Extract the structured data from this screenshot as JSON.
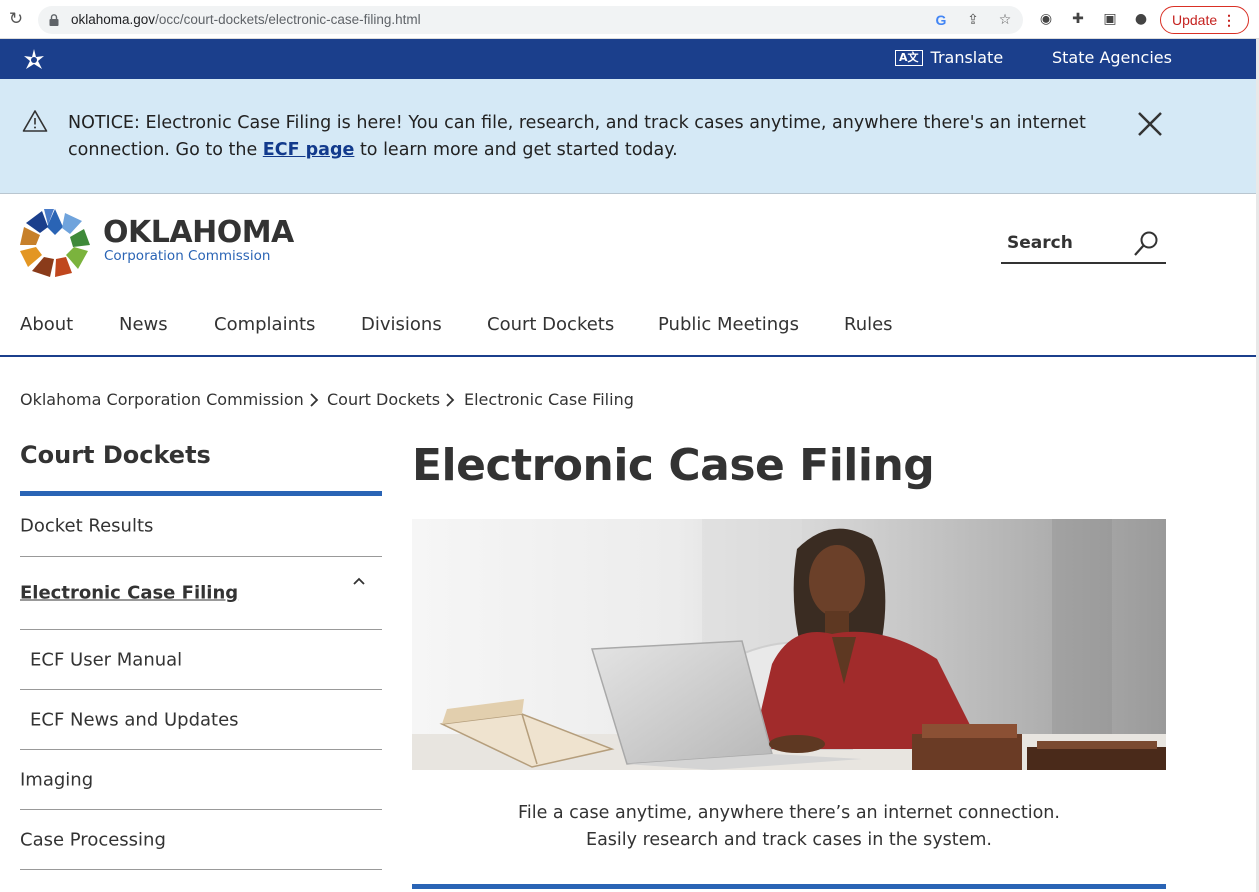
{
  "browser": {
    "url_host": "oklahoma.gov",
    "url_path": "/occ/court-dockets/electronic-case-filing.html",
    "update_label": "Update"
  },
  "state_bar": {
    "translate_label": "Translate",
    "translate_icon_text": "A文",
    "agencies_label": "State Agencies"
  },
  "notice": {
    "text_before": "NOTICE: Electronic Case Filing is here! You can file, research, and track cases anytime, anywhere there's an internet connection. Go to the ",
    "link_text": "ECF page",
    "text_after": " to learn more and get started today."
  },
  "logo": {
    "name": "OKLAHOMA",
    "subtitle": "Corporation Commission"
  },
  "search": {
    "label": "Search"
  },
  "nav": {
    "items": [
      {
        "label": "About"
      },
      {
        "label": "News"
      },
      {
        "label": "Complaints"
      },
      {
        "label": "Divisions"
      },
      {
        "label": "Court Dockets"
      },
      {
        "label": "Public Meetings"
      },
      {
        "label": "Rules"
      }
    ]
  },
  "breadcrumb": {
    "items": [
      {
        "label": "Oklahoma Corporation Commission"
      },
      {
        "label": "Court Dockets"
      },
      {
        "label": "Electronic Case Filing"
      }
    ]
  },
  "sidebar": {
    "title": "Court Dockets",
    "items": [
      {
        "label": "Docket Results"
      },
      {
        "label": "Electronic Case Filing"
      },
      {
        "label": "ECF User Manual"
      },
      {
        "label": "ECF News and Updates"
      },
      {
        "label": "Imaging"
      },
      {
        "label": "Case Processing"
      }
    ]
  },
  "main": {
    "title": "Electronic Case Filing",
    "caption_line1": "File a case anytime, anywhere there’s an internet connection.",
    "caption_line2": "Easily research and track cases in the system."
  },
  "colors": {
    "state_blue": "#1b3f8c",
    "accent_blue": "#2a64b5",
    "notice_bg": "#d5e9f6"
  }
}
